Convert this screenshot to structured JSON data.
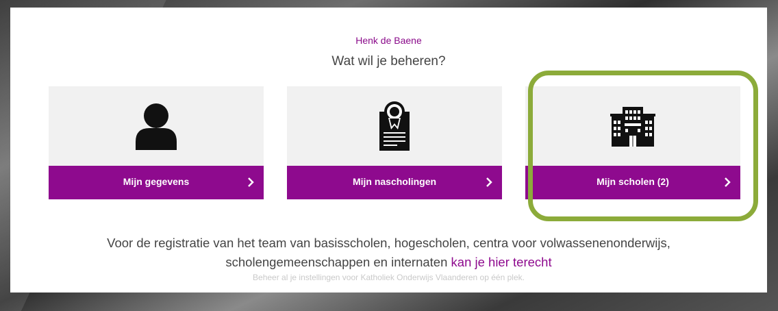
{
  "header": {
    "user_name": "Henk de Baene",
    "question": "Wat wil je beheren?"
  },
  "cards": [
    {
      "label": "Mijn gegevens",
      "icon": "person-icon"
    },
    {
      "label": "Mijn nascholingen",
      "icon": "certificate-icon"
    },
    {
      "label": "Mijn scholen (2)",
      "icon": "school-building-icon"
    }
  ],
  "registration": {
    "text_line1": "Voor de registratie van het team van basisscholen, hogescholen, centra voor volwassenenonderwijs,",
    "text_line2": "scholengemeenschappen en internaten",
    "link": "kan je hier terecht"
  },
  "tagline": "Beheer al je instellingen voor Katholiek Onderwijs Vlaanderen op één plek.",
  "colors": {
    "accent": "#8e0a8e",
    "highlight": "#8cab3a",
    "card_bg": "#f1f1f1"
  }
}
